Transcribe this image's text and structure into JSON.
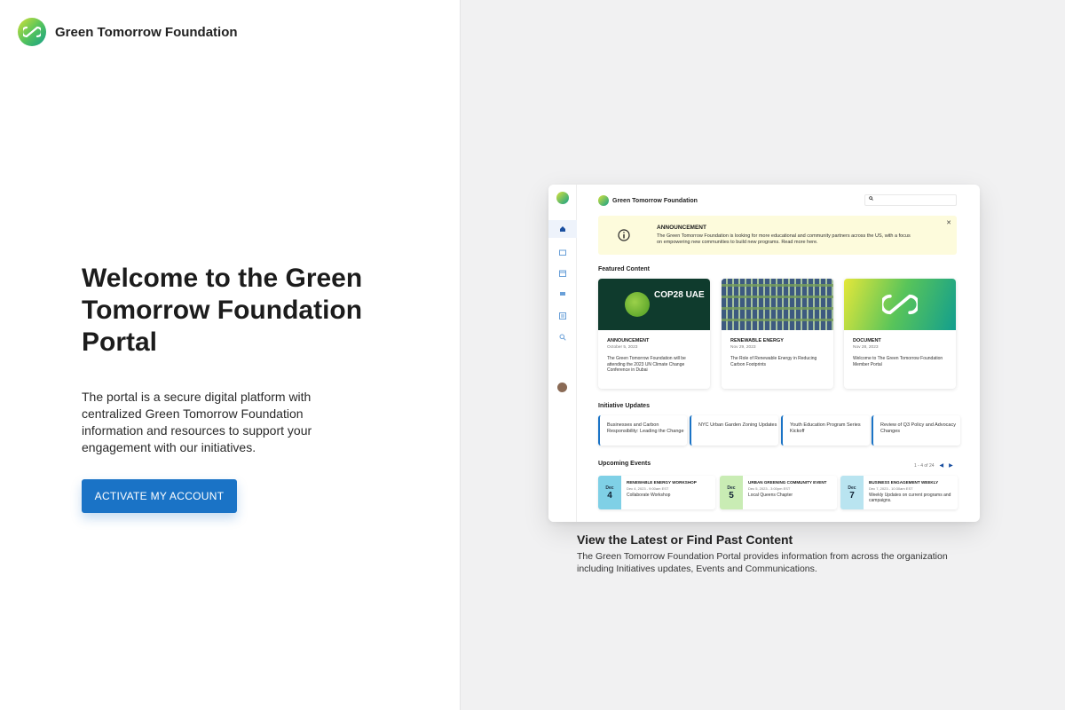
{
  "brand": {
    "name": "Green Tomorrow Foundation"
  },
  "hero": {
    "title": "Welcome to the Green Tomorrow Foundation Portal",
    "body": "The portal is a secure digital platform with centralized Green Tomorrow Foundation information and resources to support your engagement with our initiatives.",
    "cta_label": "ACTIVATE MY ACCOUNT"
  },
  "colors": {
    "primary": "#1a73c6",
    "announce_bg": "#fdfbdc",
    "panel_bg": "#f1f1f2"
  },
  "preview": {
    "header_title": "Green Tomorrow Foundation",
    "sidebar_icons": [
      "home-icon",
      "folder-icon",
      "calendar-icon",
      "flag-icon",
      "list-icon",
      "search-icon"
    ],
    "announcement": {
      "title": "ANNOUNCEMENT",
      "text": "The Green Tomorrow Foundation is looking for more educational and community partners across the US, with a focus on empowering new communities to build new programs. Read more here."
    },
    "featured_heading": "Featured Content",
    "cards": [
      {
        "label": "ANNOUNCEMENT",
        "date": "October 5, 2023",
        "desc": "The Green Tomorrow Foundation will be attending the 2023 UN Climate Change Conference in Dubai",
        "image_text": "COP28 UAE"
      },
      {
        "label": "RENEWABLE ENERGY",
        "date": "Nov 29, 2023",
        "desc": "The Role of Renewable Energy in Reducing Carbon Footprints"
      },
      {
        "label": "DOCUMENT",
        "date": "Nov 28, 2023",
        "desc": "Welcome to The Green Tomorrow Foundation Member Portal"
      }
    ],
    "updates_heading": "Initiative Updates",
    "updates": [
      "Businesses and Carbon Responsibility: Leading the Change",
      "NYC Urban Garden Zoning Updates",
      "Youth Education Program Series Kickoff",
      "Review of Q3 Policy and Advocacy Changes"
    ],
    "events_heading": "Upcoming Events",
    "pager": "1 - 4 of 24",
    "events": [
      {
        "month": "Dec",
        "day": "4",
        "title": "RENEWABLE ENERGY WORKSHOP",
        "time": "Dec 4, 2023 - 9:00am EST",
        "name": "Collaborate Workshop",
        "color": "#7fd0e6"
      },
      {
        "month": "Dec",
        "day": "5",
        "title": "URBAN GREENING COMMUNITY EVENT",
        "time": "Dec 5, 2023 - 3:00pm EST",
        "name": "Local Queens Chapter",
        "color": "#c9ecb4"
      },
      {
        "month": "Dec",
        "day": "7",
        "title": "BUSINESS ENGAGEMENT WEEKLY",
        "time": "Dec 7, 2023 - 10:30am EST",
        "name": "Weekly Updates on current programs and campaigns.",
        "color": "#b9e4f0"
      }
    ]
  },
  "caption": {
    "title": "View the Latest or Find Past Content",
    "body": "The Green Tomorrow Foundation Portal provides information from across the organization including Initiatives updates, Events and Communications."
  }
}
